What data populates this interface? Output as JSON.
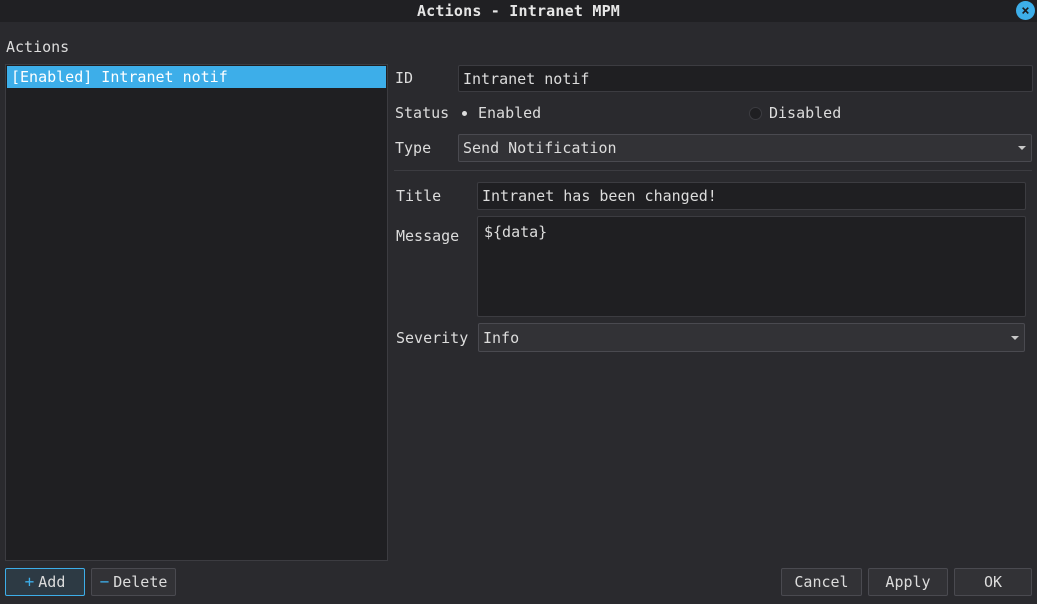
{
  "window": {
    "title": "Actions - Intranet MPM",
    "close_glyph": "×"
  },
  "sidebar": {
    "label": "Actions",
    "items": [
      {
        "label": "[Enabled] Intranet notif",
        "selected": true
      }
    ]
  },
  "form": {
    "id_label": "ID",
    "id_value": "Intranet notif",
    "status_label": "Status",
    "status_options": {
      "enabled": "Enabled",
      "disabled": "Disabled"
    },
    "status_selected": "Enabled",
    "type_label": "Type",
    "type_value": "Send Notification",
    "title_label": "Title",
    "title_value": "Intranet has been changed!",
    "message_label": "Message",
    "message_value": "${data}",
    "severity_label": "Severity",
    "severity_value": "Info"
  },
  "buttons": {
    "add": {
      "label": "Add",
      "icon": "+"
    },
    "delete": {
      "label": "Delete",
      "icon": "−"
    },
    "cancel": "Cancel",
    "apply": "Apply",
    "ok": "OK"
  },
  "colors": {
    "accent": "#3daee9",
    "background": "#2a2a2e",
    "field": "#1f1f22"
  }
}
